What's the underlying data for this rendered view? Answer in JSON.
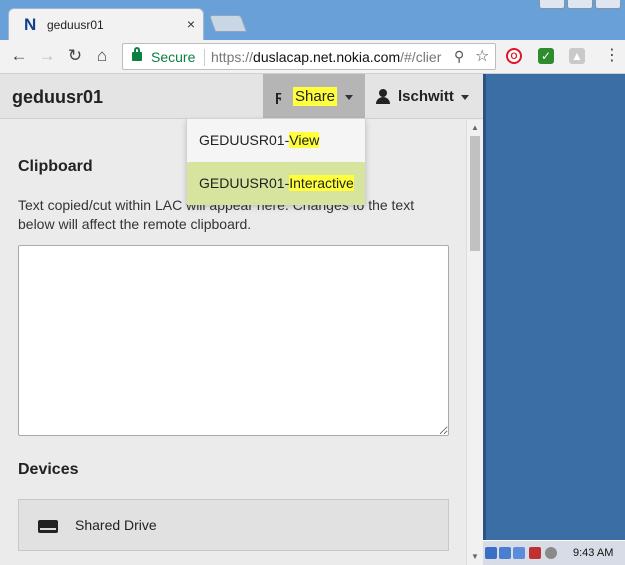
{
  "browser": {
    "tab_title": "geduusr01",
    "tab_favicon": "N",
    "tab_close": "×",
    "secure_label": "Secure",
    "url_scheme": "https://",
    "url_host": "duslacap.net.nokia.com",
    "url_path": "/#/clier"
  },
  "app": {
    "title": "geduusr01",
    "share_label": "Share",
    "user_label": "lschwitt"
  },
  "share_menu": {
    "items": [
      {
        "prefix": "GEDUUSR01-",
        "suffix": "View"
      },
      {
        "prefix": "GEDUUSR01-",
        "suffix": "Interactive"
      }
    ]
  },
  "clipboard": {
    "title": "Clipboard",
    "description": "Text copied/cut within LAC will appear here. Changes to the text below will affect the remote clipboard.",
    "value": ""
  },
  "devices": {
    "title": "Devices",
    "items": [
      {
        "label": "Shared Drive",
        "icon": "drive-icon"
      }
    ]
  },
  "taskbar": {
    "clock": "9:43 AM"
  },
  "colors": {
    "highlight": "#ffff3b",
    "active_item": "#d6e49d",
    "secure_green": "#0b8043"
  }
}
